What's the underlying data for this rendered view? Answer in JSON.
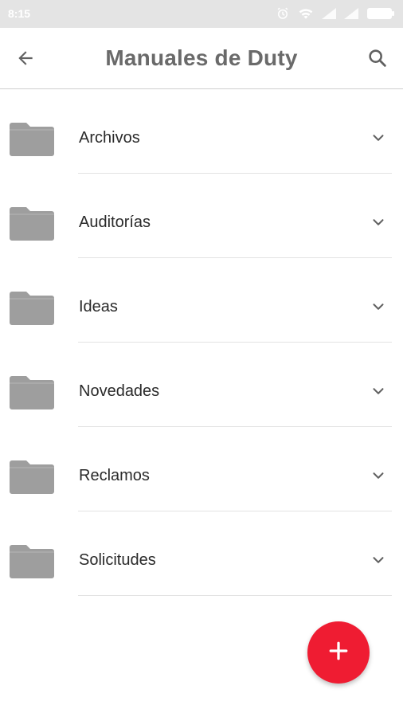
{
  "status_bar": {
    "time": "8:15"
  },
  "app_bar": {
    "title": "Manuales de Duty",
    "back_icon": "arrow-back-icon",
    "search_icon": "search-icon"
  },
  "folders": [
    {
      "label": "Archivos"
    },
    {
      "label": "Auditorías"
    },
    {
      "label": "Ideas"
    },
    {
      "label": "Novedades"
    },
    {
      "label": "Reclamos"
    },
    {
      "label": "Solicitudes"
    }
  ],
  "fab": {
    "icon": "plus-icon"
  },
  "colors": {
    "accent": "#ef1c32",
    "folder": "#9e9e9e",
    "title": "#6a6a6a",
    "status_bar": "#e4e4e4"
  }
}
